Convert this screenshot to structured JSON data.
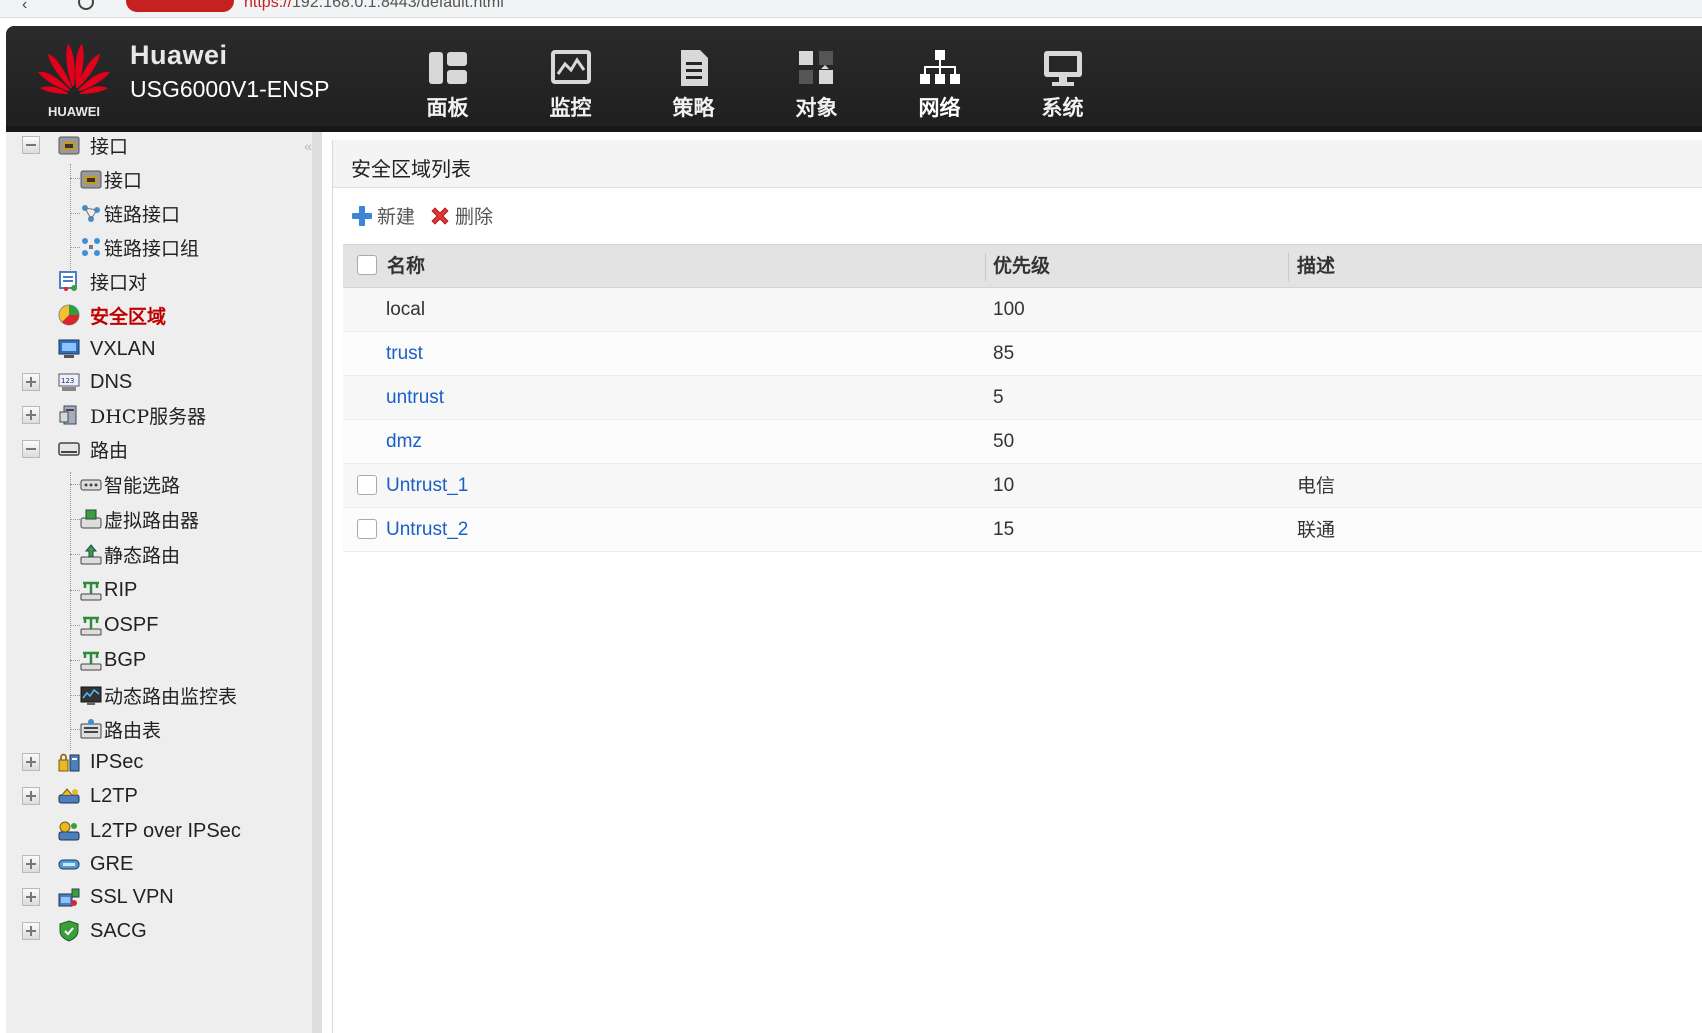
{
  "browser": {
    "url_scheme": "https://",
    "url_rest": "192.168.0.1:8443/default.html"
  },
  "header": {
    "brand_name": "Huawei",
    "brand_model": "USG6000V1-ENSP",
    "logo_text": "HUAWEI",
    "nav": [
      {
        "label": "面板",
        "icon": "dashboard-icon"
      },
      {
        "label": "监控",
        "icon": "monitor-icon"
      },
      {
        "label": "策略",
        "icon": "policy-icon"
      },
      {
        "label": "对象",
        "icon": "object-icon"
      },
      {
        "label": "网络",
        "icon": "network-icon"
      },
      {
        "label": "系统",
        "icon": "system-icon"
      }
    ]
  },
  "sidebar": {
    "collapse": "«",
    "items": [
      {
        "label": "接口"
      },
      {
        "label": "接口"
      },
      {
        "label": "链路接口"
      },
      {
        "label": "链路接口组"
      },
      {
        "label": "接口对"
      },
      {
        "label": "安全区域"
      },
      {
        "label": "VXLAN"
      },
      {
        "label": "DNS"
      },
      {
        "label": "DHCP服务器"
      },
      {
        "label": "路由"
      },
      {
        "label": "智能选路"
      },
      {
        "label": "虚拟路由器"
      },
      {
        "label": "静态路由"
      },
      {
        "label": "RIP"
      },
      {
        "label": "OSPF"
      },
      {
        "label": "BGP"
      },
      {
        "label": "动态路由监控表"
      },
      {
        "label": "路由表"
      },
      {
        "label": "IPSec"
      },
      {
        "label": "L2TP"
      },
      {
        "label": "L2TP over IPSec"
      },
      {
        "label": "GRE"
      },
      {
        "label": "SSL VPN"
      },
      {
        "label": "SACG"
      }
    ]
  },
  "main": {
    "title": "安全区域列表",
    "toolbar": {
      "new_label": "新建",
      "delete_label": "删除"
    },
    "columns": [
      "名称",
      "优先级",
      "描述"
    ],
    "rows": [
      {
        "name": "local",
        "priority": "100",
        "desc": ""
      },
      {
        "name": "trust",
        "priority": "85",
        "desc": ""
      },
      {
        "name": "untrust",
        "priority": "5",
        "desc": ""
      },
      {
        "name": "dmz",
        "priority": "50",
        "desc": ""
      },
      {
        "name": "Untrust_1",
        "priority": "10",
        "desc": "电信"
      },
      {
        "name": "Untrust_2",
        "priority": "15",
        "desc": "联通"
      }
    ]
  },
  "colors": {
    "header_bg": "#252525",
    "active_red": "#c00000",
    "link_blue": "#1a5fc6",
    "logo_red": "#e3001b"
  }
}
